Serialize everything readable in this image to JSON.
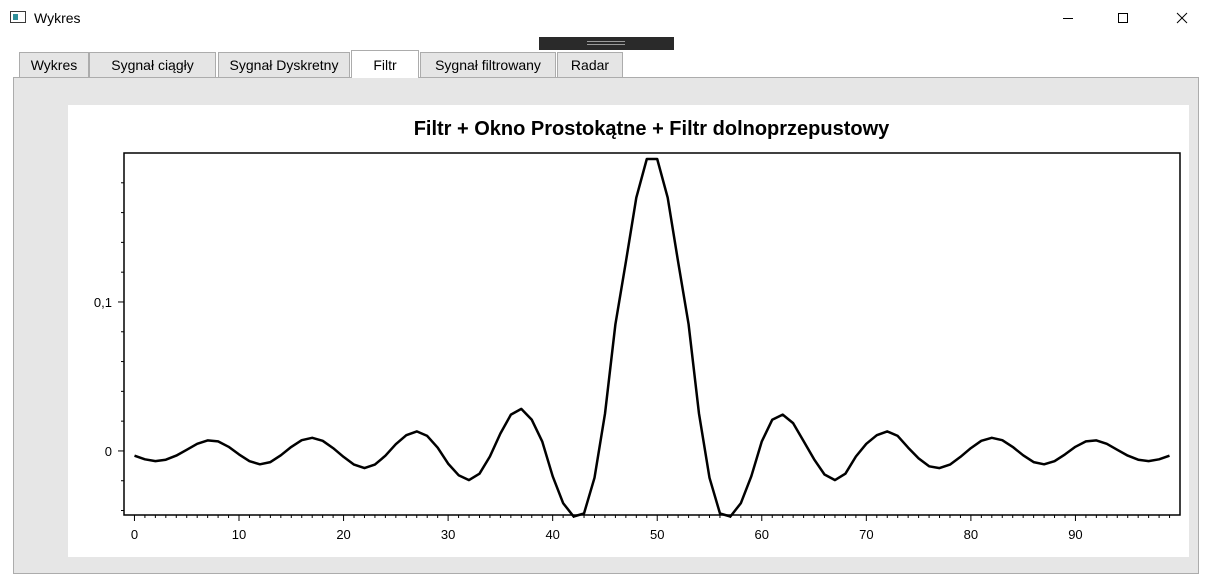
{
  "window": {
    "title": "Wykres"
  },
  "tabs": [
    {
      "label": "Wykres",
      "active": false
    },
    {
      "label": "Sygnał ciągły",
      "active": false
    },
    {
      "label": "Sygnał Dyskretny",
      "active": false
    },
    {
      "label": "Filtr",
      "active": true
    },
    {
      "label": "Sygnał filtrowany",
      "active": false
    },
    {
      "label": "Radar",
      "active": false
    }
  ],
  "chart_data": {
    "type": "line",
    "title": "Filtr + Okno Prostokątne + Filtr dolnoprzepustowy",
    "xlabel": "",
    "ylabel": "",
    "xlim": [
      -1,
      100
    ],
    "ylim": [
      -0.043,
      0.2
    ],
    "x_ticks": [
      0,
      10,
      20,
      30,
      40,
      50,
      60,
      70,
      80,
      90
    ],
    "y_ticks": [
      0,
      0.1
    ],
    "y_tick_labels": [
      "0",
      "0,1"
    ],
    "grid": false,
    "series": [
      {
        "values": [
          -0.0032,
          -0.0056,
          -0.0068,
          -0.0059,
          -0.0031,
          0.0008,
          0.0048,
          0.0071,
          0.0064,
          0.0028,
          -0.0023,
          -0.0069,
          -0.009,
          -0.0075,
          -0.0029,
          0.0027,
          0.0072,
          0.0088,
          0.0068,
          0.0019,
          -0.004,
          -0.0092,
          -0.0115,
          -0.0092,
          -0.0032,
          0.0045,
          0.0106,
          0.0131,
          0.0101,
          0.0022,
          -0.0085,
          -0.0163,
          -0.0196,
          -0.0153,
          -0.0037,
          0.0117,
          0.0244,
          0.0282,
          0.0209,
          0.0064,
          -0.017,
          -0.035,
          -0.044,
          -0.042,
          -0.018,
          0.025,
          0.085,
          0.127,
          0.17,
          0.196,
          0.196,
          0.17,
          0.127,
          0.085,
          0.025,
          -0.018,
          -0.042,
          -0.044,
          -0.035,
          -0.017,
          0.0064,
          0.0209,
          0.0244,
          0.0187,
          0.0066,
          -0.0056,
          -0.0158,
          -0.0196,
          -0.0153,
          -0.0037,
          0.0048,
          0.0106,
          0.0131,
          0.0101,
          0.0022,
          -0.005,
          -0.0103,
          -0.0115,
          -0.0092,
          -0.004,
          0.0019,
          0.0068,
          0.0088,
          0.0072,
          0.0027,
          -0.0029,
          -0.0075,
          -0.009,
          -0.0069,
          -0.0023,
          0.0028,
          0.0064,
          0.0071,
          0.0048,
          0.0008,
          -0.0031,
          -0.0059,
          -0.0068,
          -0.0056,
          -0.0032
        ]
      }
    ]
  }
}
